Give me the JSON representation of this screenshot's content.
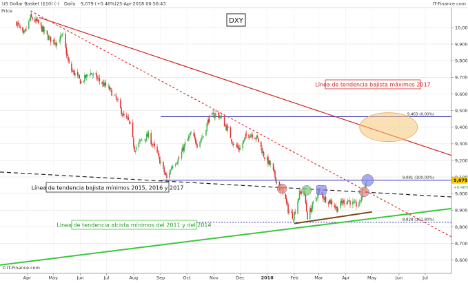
{
  "header": {
    "title_left": "US Dollar Basket ($10) (-)",
    "period": "Daily",
    "quote": "9,079 (+0.46%)",
    "timestamp": "25-Apr-2018 06:56:43",
    "brand": "IT-Finance.com",
    "price_label": "Price"
  },
  "footer": {
    "copyright": "©IT-Finance.com"
  },
  "colors": {
    "up_candle": "#3cb44b",
    "down_candle": "#e03030",
    "resistance_2017": "#d42020",
    "dashed_red": "#e03030",
    "black_dashed": "#222222",
    "green_support": "#38c838",
    "fib_lines": "#2a2aa8",
    "brown_support": "#7a4a1a",
    "ellipse_orange": "#f6c878"
  },
  "chart_data": {
    "type": "candlestick",
    "title": "DXY",
    "x_ticks": [
      "Apr",
      "May",
      "Jun",
      "Jul",
      "Aug",
      "Sep",
      "Oct",
      "Nov",
      "Dec",
      "2018",
      "Feb",
      "Mar",
      "Apr",
      "May",
      "Jun",
      "Jul"
    ],
    "y_ticks": [
      "10,000",
      "9,900",
      "9,800",
      "9,700",
      "9,600",
      "9,500",
      "9,400",
      "9,300",
      "9,200",
      "9,100",
      "9,000",
      "8,900",
      "8,800",
      "8,700",
      "8,600"
    ],
    "ylim": [
      8.52,
      10.12
    ],
    "last_price_label": "9,079",
    "change_label": "+0.46%",
    "anchors": [
      {
        "d": "2017-03-20",
        "v": 10.03
      },
      {
        "d": "2017-03-28",
        "v": 9.95
      },
      {
        "d": "2017-04-05",
        "v": 10.06
      },
      {
        "d": "2017-04-13",
        "v": 10.03
      },
      {
        "d": "2017-04-21",
        "v": 9.97
      },
      {
        "d": "2017-04-27",
        "v": 9.93
      },
      {
        "d": "2017-05-05",
        "v": 9.91
      },
      {
        "d": "2017-05-12",
        "v": 9.95
      },
      {
        "d": "2017-05-20",
        "v": 9.75
      },
      {
        "d": "2017-05-26",
        "v": 9.72
      },
      {
        "d": "2017-06-02",
        "v": 9.67
      },
      {
        "d": "2017-06-12",
        "v": 9.73
      },
      {
        "d": "2017-06-23",
        "v": 9.68
      },
      {
        "d": "2017-07-04",
        "v": 9.63
      },
      {
        "d": "2017-07-12",
        "v": 9.57
      },
      {
        "d": "2017-07-20",
        "v": 9.47
      },
      {
        "d": "2017-07-27",
        "v": 9.43
      },
      {
        "d": "2017-08-02",
        "v": 9.27
      },
      {
        "d": "2017-08-10",
        "v": 9.32
      },
      {
        "d": "2017-08-18",
        "v": 9.35
      },
      {
        "d": "2017-08-28",
        "v": 9.24
      },
      {
        "d": "2017-09-08",
        "v": 9.09
      },
      {
        "d": "2017-09-15",
        "v": 9.18
      },
      {
        "d": "2017-09-22",
        "v": 9.21
      },
      {
        "d": "2017-09-29",
        "v": 9.3
      },
      {
        "d": "2017-10-06",
        "v": 9.36
      },
      {
        "d": "2017-10-13",
        "v": 9.3
      },
      {
        "d": "2017-10-20",
        "v": 9.35
      },
      {
        "d": "2017-10-26",
        "v": 9.45
      },
      {
        "d": "2017-11-03",
        "v": 9.48
      },
      {
        "d": "2017-11-09",
        "v": 9.46
      },
      {
        "d": "2017-11-17",
        "v": 9.38
      },
      {
        "d": "2017-11-24",
        "v": 9.29
      },
      {
        "d": "2017-12-01",
        "v": 9.27
      },
      {
        "d": "2017-12-08",
        "v": 9.35
      },
      {
        "d": "2017-12-14",
        "v": 9.36
      },
      {
        "d": "2017-12-21",
        "v": 9.33
      },
      {
        "d": "2017-12-29",
        "v": 9.22
      },
      {
        "d": "2018-01-05",
        "v": 9.17
      },
      {
        "d": "2018-01-10",
        "v": 9.1
      },
      {
        "d": "2018-01-15",
        "v": 9.03
      },
      {
        "d": "2018-01-19",
        "v": 9.02
      },
      {
        "d": "2018-01-25",
        "v": 8.9
      },
      {
        "d": "2018-01-31",
        "v": 8.86
      },
      {
        "d": "2018-02-07",
        "v": 9.0
      },
      {
        "d": "2018-02-12",
        "v": 9.02
      },
      {
        "d": "2018-02-16",
        "v": 8.86
      },
      {
        "d": "2018-02-22",
        "v": 8.93
      },
      {
        "d": "2018-03-01",
        "v": 9.01
      },
      {
        "d": "2018-03-08",
        "v": 8.97
      },
      {
        "d": "2018-03-15",
        "v": 8.95
      },
      {
        "d": "2018-03-22",
        "v": 8.91
      },
      {
        "d": "2018-03-28",
        "v": 8.95
      },
      {
        "d": "2018-04-04",
        "v": 8.96
      },
      {
        "d": "2018-04-11",
        "v": 8.93
      },
      {
        "d": "2018-04-17",
        "v": 8.94
      },
      {
        "d": "2018-04-20",
        "v": 9.01
      },
      {
        "d": "2018-04-25",
        "v": 9.079
      }
    ],
    "fibonacci": [
      {
        "label": "9,463 (0.00%)",
        "level": 9.463
      },
      {
        "label": "9,081 (100.00%)",
        "level": 9.081
      },
      {
        "label": "8,828 (161.80%)",
        "level": 8.828
      }
    ],
    "trendlines": [
      {
        "name": "Línea de tendencia bajista máximos 2017",
        "style": "solid",
        "from": {
          "d": "2017-04-15",
          "v": 10.06
        },
        "to": {
          "d": "2018-07-31",
          "v": 9.23
        }
      },
      {
        "name": "Línea de tendencia bajista mínimos 2015, 2016 y 2017",
        "style": "dashed",
        "from": {
          "d": "2017-03-01",
          "v": 9.13
        },
        "to": {
          "d": "2018-07-31",
          "v": 8.98
        }
      },
      {
        "name": "Línea de tendencia alcista mínimos del 2011 y del 2014",
        "style": "solid",
        "from": {
          "d": "2017-03-01",
          "v": 8.57
        },
        "to": {
          "d": "2018-07-31",
          "v": 8.91
        }
      },
      {
        "name": "",
        "style": "dashed",
        "from": {
          "d": "2017-04-05",
          "v": 10.1
        },
        "to": {
          "d": "2018-07-31",
          "v": 8.74
        }
      },
      {
        "name": "",
        "style": "solid",
        "from": {
          "d": "2018-02-01",
          "v": 8.82
        },
        "to": {
          "d": "2018-05-01",
          "v": 8.89
        }
      }
    ],
    "markers": [
      {
        "color": "#f08080",
        "d": "2018-01-18",
        "v": 9.03
      },
      {
        "color": "#77cc77",
        "d": "2018-02-15",
        "v": 9.02
      },
      {
        "color": "#8888ee",
        "d": "2018-03-04",
        "v": 9.02
      },
      {
        "color": "#f08080",
        "d": "2018-04-22",
        "v": 9.01
      },
      {
        "color": "#8888ee",
        "d": "2018-04-26",
        "v": 9.08
      }
    ],
    "annotations": [
      "Línea de tendencia bajista máximos 2017",
      "Línea de tendencia bajista mínimos 2015, 2016 y 2017",
      "Línea de tendencia alcista mínimos del 2011 y del 2014"
    ],
    "target_zone": {
      "d": "2018-05-20",
      "v": 9.4
    }
  }
}
